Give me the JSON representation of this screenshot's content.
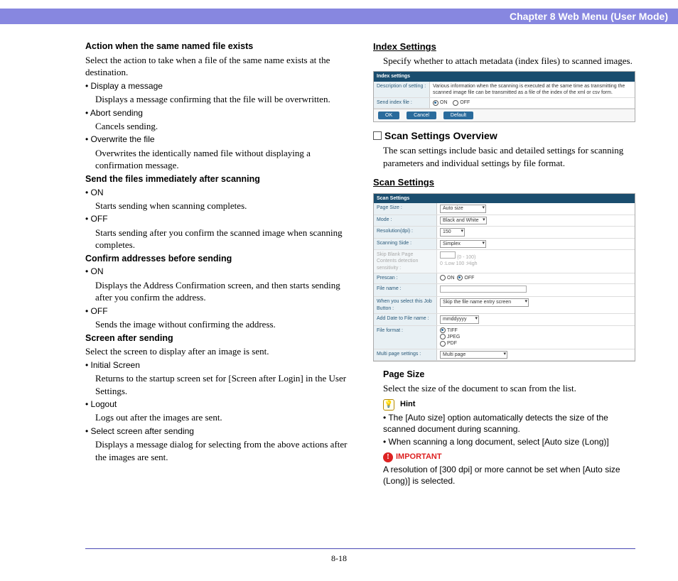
{
  "header": {
    "title": "Chapter 8   Web Menu (User Mode)"
  },
  "pageNumber": "8-18",
  "left": {
    "h1": "Action when the same named file exists",
    "h1_desc": "Select the action to take when a file of the same name exists at the destination.",
    "b1": "• Display a message",
    "b1_desc": "Displays a message confirming that the file will be overwritten.",
    "b2": "• Abort sending",
    "b2_desc": "Cancels sending.",
    "b3": "• Overwrite the file",
    "b3_desc": "Overwrites the identically named file without displaying a confirmation message.",
    "h2": "Send the files immediately after scanning",
    "b4": "• ON",
    "b4_desc": "Starts sending when scanning completes.",
    "b5": "• OFF",
    "b5_desc": "Starts sending after you confirm the scanned image when scanning completes.",
    "h3": "Confirm addresses before sending",
    "b6": "• ON",
    "b6_desc": "Displays the Address Confirmation screen, and then starts sending after you confirm the address.",
    "b7": "• OFF",
    "b7_desc": "Sends the image without confirming the address.",
    "h4": "Screen after sending",
    "h4_desc": "Select the screen to display after an image is sent.",
    "b8": "• Initial Screen",
    "b8_desc": "Returns to the startup screen set for [Screen after Login] in the User Settings.",
    "b9": "• Logout",
    "b9_desc": "Logs out after the images are sent.",
    "b10": "• Select screen after sending",
    "b10_desc": "Displays a message dialog for selecting from the above actions after the images are sent."
  },
  "right": {
    "index_title": "Index Settings",
    "index_desc": "Specify whether to attach metadata (index files) to scanned images.",
    "ss1": {
      "header": "Index settings",
      "row1_label": "Description of setting :",
      "row1_val": "Various information when the scanning is executed at the same time as transmitting the scanned image file can be transmitted as a file of the index of the xml or csv form.",
      "row2_label": "Send index file :",
      "row2_on": "ON",
      "row2_off": "OFF",
      "btn_ok": "OK",
      "btn_cancel": "Cancel",
      "btn_default": "Default"
    },
    "overview_title": "Scan Settings Overview",
    "overview_desc": "The scan settings include basic and detailed settings for scanning parameters and individual settings by file format.",
    "scan_title": "Scan Settings",
    "ss2": {
      "header": "Scan Settings",
      "page_size_l": "Page Size :",
      "page_size_v": "Auto size",
      "mode_l": "Mode :",
      "mode_v": "Black and White",
      "res_l": "Resolution(dpi) :",
      "res_v": "150",
      "side_l": "Scanning Side :",
      "side_v": "Simplex",
      "skip_l": "Skip Blank Page Contents detection sensitivity :",
      "skip_v": "(0 - 100)",
      "skip_v2": "0 :Low 100 :High",
      "prescan_l": "Prescan :",
      "on": "ON",
      "off": "OFF",
      "fname_l": "File name :",
      "job_l": "When you select this Job Button :",
      "job_v": "Skip the file name entry screen",
      "date_l": "Add Date to File name :",
      "date_v": "mmddyyyy",
      "fmt_l": "File format :",
      "fmt_tiff": "TIFF",
      "fmt_jpeg": "JPEG",
      "fmt_pdf": "PDF",
      "multi_l": "Multi page settings :",
      "multi_v": "Multi page"
    },
    "pagesize_h": "Page Size",
    "pagesize_desc": "Select the size of the document to scan from the list.",
    "hint_label": "Hint",
    "hint1": "• The [Auto size] option automatically detects the size of the scanned document during scanning.",
    "hint2": "• When scanning a long document, select [Auto size (Long)]",
    "important_label": "IMPORTANT",
    "important_text": "A resolution of [300 dpi] or more cannot be set when [Auto size (Long)] is selected."
  }
}
